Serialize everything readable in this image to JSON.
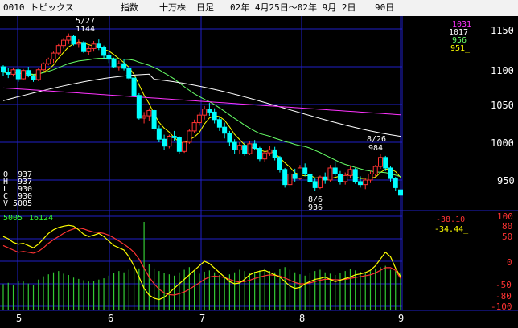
{
  "header": {
    "code_name": "0010 トピックス",
    "kind": "指数",
    "unit": "十万株",
    "period_label": "日足",
    "range": "02年 4月25日〜02年 9月 2日",
    "count": "90日"
  },
  "price_panel": {
    "y_ticks": [
      "1150",
      "1100",
      "1050",
      "1000",
      "950"
    ],
    "ma_values": [
      {
        "label": "1031",
        "color": "#ff33ff"
      },
      {
        "label": "1017",
        "color": "#ffffff"
      },
      {
        "label": "956",
        "color": "#66ff66"
      },
      {
        "label": "951_",
        "color": "#ffff00"
      }
    ],
    "annotations": {
      "high_date": "5/27",
      "high_value": "1144",
      "low_date": "8/6",
      "low_value": "936",
      "late_high_date": "8/26",
      "late_high_value": "984"
    },
    "ohlcv": [
      {
        "key": "O",
        "value": "937"
      },
      {
        "key": "H",
        "value": "937"
      },
      {
        "key": "L",
        "value": "930"
      },
      {
        "key": "C",
        "value": "930"
      },
      {
        "key": "V",
        "value": "5005"
      }
    ]
  },
  "volume_panel": {
    "volume_label": "5005",
    "volume_avg_label": "16124",
    "oscillator_red": "-38.10",
    "oscillator_yellow": "-34.44_",
    "y_ticks": [
      "100",
      "80",
      "50",
      "0",
      "-50",
      "-80",
      "-100"
    ]
  },
  "x_axis": {
    "months": [
      "5",
      "6",
      "7",
      "8",
      "9"
    ]
  },
  "colors": {
    "background": "#000000",
    "grid": "#2020c8",
    "up_candle": "#ff3333",
    "down_candle": "#00ffff",
    "ma_short": "#ffff00",
    "ma_mid": "#66ff66",
    "ma_long": "#ffffff",
    "ma_verylong": "#ff33ff",
    "volume": "#33cc33"
  },
  "chart_data": {
    "type": "candlestick",
    "candles": [
      [
        1100,
        1102,
        1088,
        1093
      ],
      [
        1093,
        1098,
        1085,
        1090
      ],
      [
        1090,
        1099,
        1087,
        1096
      ],
      [
        1096,
        1098,
        1080,
        1084
      ],
      [
        1084,
        1097,
        1082,
        1095
      ],
      [
        1095,
        1100,
        1086,
        1088
      ],
      [
        1088,
        1090,
        1080,
        1083
      ],
      [
        1083,
        1098,
        1081,
        1096
      ],
      [
        1096,
        1106,
        1094,
        1104
      ],
      [
        1104,
        1112,
        1102,
        1110
      ],
      [
        1110,
        1120,
        1105,
        1118
      ],
      [
        1118,
        1130,
        1115,
        1128
      ],
      [
        1128,
        1138,
        1124,
        1135
      ],
      [
        1135,
        1144,
        1130,
        1140
      ],
      [
        1140,
        1142,
        1128,
        1130
      ],
      [
        1130,
        1136,
        1125,
        1132
      ],
      [
        1132,
        1134,
        1118,
        1120
      ],
      [
        1120,
        1128,
        1115,
        1124
      ],
      [
        1124,
        1134,
        1120,
        1130
      ],
      [
        1130,
        1136,
        1122,
        1125
      ],
      [
        1125,
        1128,
        1110,
        1115
      ],
      [
        1115,
        1120,
        1105,
        1110
      ],
      [
        1110,
        1112,
        1098,
        1100
      ],
      [
        1100,
        1108,
        1095,
        1104
      ],
      [
        1104,
        1110,
        1095,
        1098
      ],
      [
        1098,
        1100,
        1082,
        1085
      ],
      [
        1085,
        1088,
        1060,
        1062
      ],
      [
        1062,
        1065,
        1030,
        1032
      ],
      [
        1032,
        1040,
        1025,
        1035
      ],
      [
        1035,
        1045,
        1028,
        1042
      ],
      [
        1042,
        1044,
        1015,
        1018
      ],
      [
        1018,
        1022,
        1000,
        1004
      ],
      [
        1004,
        1010,
        990,
        995
      ],
      [
        995,
        1010,
        992,
        1008
      ],
      [
        1008,
        1015,
        1002,
        1006
      ],
      [
        1006,
        1008,
        985,
        988
      ],
      [
        988,
        1002,
        986,
        1000
      ],
      [
        1000,
        1018,
        998,
        1015
      ],
      [
        1015,
        1030,
        1012,
        1026
      ],
      [
        1026,
        1040,
        1022,
        1036
      ],
      [
        1036,
        1048,
        1030,
        1044
      ],
      [
        1044,
        1052,
        1035,
        1040
      ],
      [
        1040,
        1045,
        1025,
        1030
      ],
      [
        1030,
        1034,
        1015,
        1020
      ],
      [
        1020,
        1026,
        1005,
        1012
      ],
      [
        1012,
        1015,
        995,
        1000
      ],
      [
        1000,
        1004,
        985,
        990
      ],
      [
        990,
        1000,
        984,
        996
      ],
      [
        996,
        1000,
        982,
        985
      ],
      [
        985,
        1002,
        983,
        998
      ],
      [
        998,
        1003,
        990,
        992
      ],
      [
        992,
        994,
        975,
        978
      ],
      [
        978,
        988,
        974,
        986
      ],
      [
        986,
        995,
        982,
        990
      ],
      [
        990,
        994,
        976,
        980
      ],
      [
        980,
        982,
        960,
        964
      ],
      [
        964,
        966,
        940,
        944
      ],
      [
        944,
        960,
        940,
        958
      ],
      [
        958,
        965,
        948,
        952
      ],
      [
        952,
        970,
        950,
        966
      ],
      [
        966,
        972,
        955,
        958
      ],
      [
        958,
        962,
        945,
        948
      ],
      [
        948,
        952,
        936,
        940
      ],
      [
        940,
        956,
        938,
        954
      ],
      [
        954,
        960,
        945,
        950
      ],
      [
        950,
        970,
        948,
        966
      ],
      [
        966,
        975,
        955,
        958
      ],
      [
        958,
        962,
        944,
        948
      ],
      [
        948,
        960,
        944,
        956
      ],
      [
        956,
        968,
        952,
        964
      ],
      [
        964,
        966,
        945,
        948
      ],
      [
        948,
        955,
        940,
        944
      ],
      [
        944,
        952,
        938,
        950
      ],
      [
        950,
        962,
        946,
        958
      ],
      [
        958,
        970,
        954,
        968
      ],
      [
        968,
        984,
        965,
        980
      ],
      [
        980,
        982,
        962,
        966
      ],
      [
        966,
        968,
        948,
        952
      ],
      [
        952,
        954,
        936,
        940
      ],
      [
        937,
        937,
        930,
        930
      ]
    ],
    "volume": [
      40,
      42,
      38,
      45,
      44,
      41,
      39,
      47,
      52,
      55,
      58,
      60,
      56,
      54,
      50,
      48,
      46,
      44,
      45,
      47,
      49,
      53,
      57,
      60,
      58,
      62,
      66,
      64,
      135,
      70,
      64,
      60,
      57,
      55,
      53,
      58,
      62,
      66,
      60,
      56,
      59,
      61,
      58,
      54,
      52,
      55,
      58,
      62,
      60,
      57,
      59,
      61,
      64,
      60,
      58,
      63,
      66,
      62,
      58,
      55,
      53,
      57,
      60,
      62,
      58,
      56,
      54,
      57,
      60,
      63,
      61,
      59,
      57,
      60,
      64,
      66,
      68,
      62,
      60,
      58
    ],
    "osc_yellow": [
      55,
      50,
      42,
      38,
      40,
      35,
      30,
      38,
      50,
      62,
      70,
      75,
      78,
      80,
      78,
      70,
      60,
      55,
      58,
      62,
      55,
      45,
      35,
      30,
      25,
      10,
      -10,
      -35,
      -60,
      -75,
      -82,
      -85,
      -80,
      -70,
      -60,
      -50,
      -40,
      -30,
      -20,
      -10,
      0,
      -5,
      -15,
      -25,
      -35,
      -45,
      -50,
      -48,
      -40,
      -30,
      -25,
      -22,
      -20,
      -25,
      -30,
      -35,
      -45,
      -55,
      -60,
      -58,
      -50,
      -45,
      -40,
      -38,
      -35,
      -40,
      -45,
      -42,
      -38,
      -35,
      -30,
      -28,
      -25,
      -20,
      -10,
      5,
      20,
      10,
      -15,
      -34
    ],
    "osc_red": [
      35,
      30,
      25,
      20,
      22,
      20,
      18,
      22,
      30,
      40,
      48,
      55,
      62,
      68,
      72,
      74,
      72,
      68,
      65,
      64,
      62,
      58,
      52,
      45,
      38,
      30,
      20,
      5,
      -15,
      -35,
      -50,
      -62,
      -70,
      -74,
      -75,
      -72,
      -68,
      -62,
      -55,
      -48,
      -40,
      -35,
      -33,
      -34,
      -36,
      -40,
      -44,
      -46,
      -45,
      -42,
      -38,
      -35,
      -32,
      -30,
      -31,
      -33,
      -37,
      -42,
      -47,
      -50,
      -50,
      -48,
      -45,
      -42,
      -40,
      -40,
      -41,
      -41,
      -40,
      -38,
      -36,
      -34,
      -32,
      -30,
      -26,
      -20,
      -14,
      -14,
      -20,
      -38
    ]
  }
}
